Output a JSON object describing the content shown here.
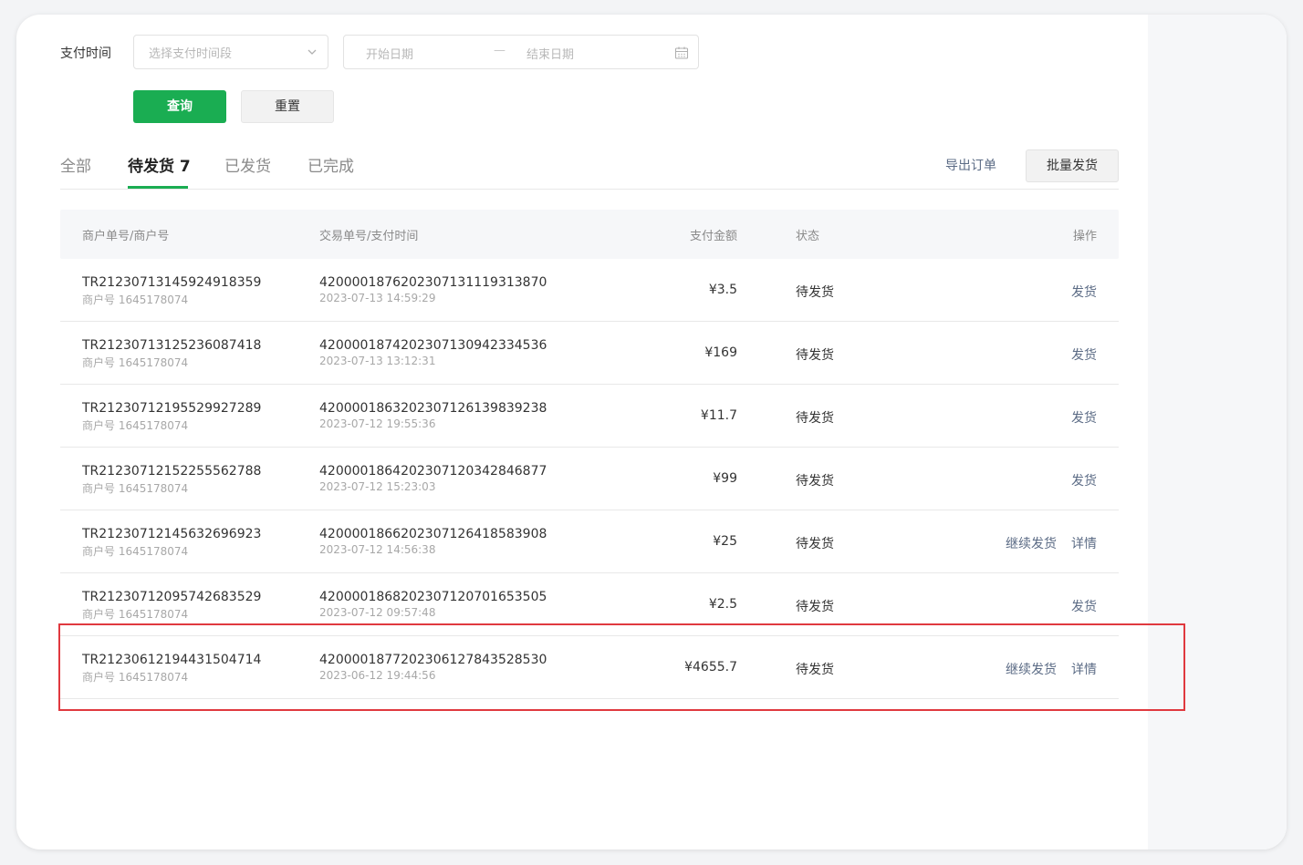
{
  "filter": {
    "label": "支付时间",
    "select_placeholder": "选择支付时间段",
    "start_placeholder": "开始日期",
    "separator": "—",
    "end_placeholder": "结束日期",
    "query_label": "查询",
    "reset_label": "重置"
  },
  "tabs": [
    {
      "label": "全部"
    },
    {
      "label": "待发货 7"
    },
    {
      "label": "已发货"
    },
    {
      "label": "已完成"
    }
  ],
  "actions": {
    "export_label": "导出订单",
    "batch_label": "批量发货"
  },
  "table": {
    "headers": {
      "id": "商户单号/商户号",
      "tx": "交易单号/支付时间",
      "amount": "支付金额",
      "status": "状态",
      "ops": "操作"
    },
    "rows": [
      {
        "order_no": "TR212307131459249183 59",
        "merchant": "商户号 1645178074",
        "tx_no": "4200001876202307131119313870",
        "paid_at": "2023-07-13 14:59:29",
        "amount": "¥3.5",
        "status": "待发货",
        "ops": [
          "发货"
        ]
      },
      {
        "order_no": "TR21230713125236087418",
        "merchant": "商户号 1645178074",
        "tx_no": "4200001874202307130942334536",
        "paid_at": "2023-07-13 13:12:31",
        "amount": "¥169",
        "status": "待发货",
        "ops": [
          "发货"
        ]
      },
      {
        "order_no": "TR21230712195529927289",
        "merchant": "商户号 1645178074",
        "tx_no": "4200001863202307126139839238",
        "paid_at": "2023-07-12 19:55:36",
        "amount": "¥11.7",
        "status": "待发货",
        "ops": [
          "发货"
        ]
      },
      {
        "order_no": "TR21230712152255562788",
        "merchant": "商户号 1645178074",
        "tx_no": "4200001864202307120342846877",
        "paid_at": "2023-07-12 15:23:03",
        "amount": "¥99",
        "status": "待发货",
        "ops": [
          "发货"
        ]
      },
      {
        "order_no": "TR21230712145632696923",
        "merchant": "商户号 1645178074",
        "tx_no": "4200001866202307126418583908",
        "paid_at": "2023-07-12 14:56:38",
        "amount": "¥25",
        "status": "待发货",
        "ops": [
          "继续发货",
          "详情"
        ]
      },
      {
        "order_no": "TR21230712095742683529",
        "merchant": "商户号 1645178074",
        "tx_no": "4200001868202307120701653505",
        "paid_at": "2023-07-12 09:57:48",
        "amount": "¥2.5",
        "status": "待发货",
        "ops": [
          "发货"
        ]
      },
      {
        "order_no": "TR21230612194431504714",
        "merchant": "商户号 1645178074",
        "tx_no": "4200001877202306127843528530",
        "paid_at": "2023-06-12 19:44:56",
        "amount": "¥4655.7",
        "status": "待发货",
        "ops": [
          "继续发货",
          "详情"
        ]
      }
    ]
  },
  "colors": {
    "primary_green": "#1aad52",
    "link": "#5b6b85",
    "highlight_red": "#e0393f"
  }
}
